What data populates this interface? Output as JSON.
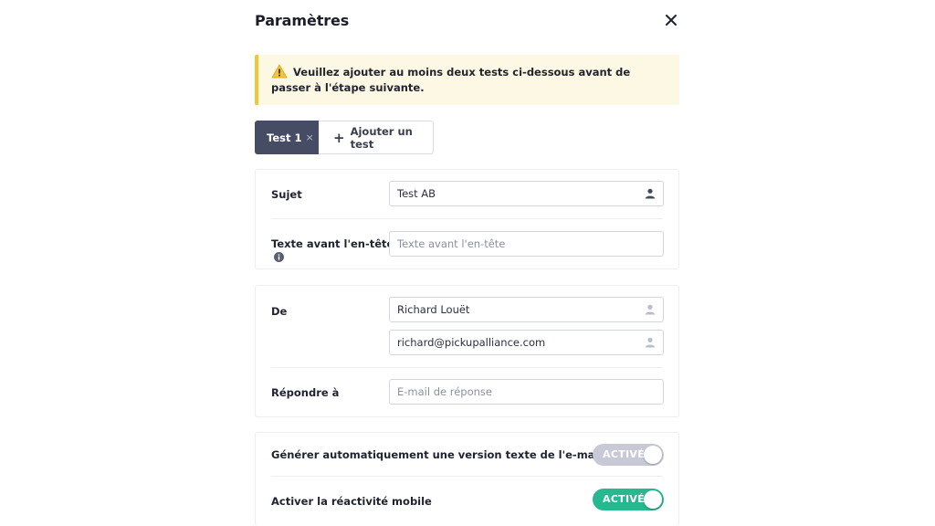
{
  "dialog": {
    "title": "Paramètres",
    "close_icon": "close-icon"
  },
  "alert": {
    "icon": "warning-icon",
    "text": "Veuillez ajouter au moins deux tests ci-dessous avant de passer à l'étape suivante."
  },
  "tabs": {
    "active_label": "Test 1",
    "active_remove": "×",
    "add_label": "Ajouter un test",
    "add_icon": "plus-icon"
  },
  "subject_section": {
    "subject_label": "Sujet",
    "subject_value": "Test AB",
    "preheader_label": "Texte avant l'en-tête",
    "preheader_placeholder": "Texte avant l'en-tête"
  },
  "sender_section": {
    "from_label": "De",
    "from_name": "Richard Louët",
    "from_email": "richard@pickupalliance.com",
    "reply_label": "Répondre à",
    "reply_placeholder": "E-mail de réponse"
  },
  "options_section": {
    "auto_text_label": "Générer automatiquement une version texte de l'e-mail",
    "auto_text_toggle": "ACTIVÉ",
    "auto_text_on": true,
    "mobile_label": "Activer la réactivité mobile",
    "mobile_toggle": "ACTIVÉ",
    "mobile_on": true
  },
  "colors": {
    "alert_bg": "#fdf8e3",
    "alert_border": "#f2c53c",
    "tab_active_bg": "#464c63",
    "toggle_green": "#28b88f",
    "toggle_grey": "#c7cad6"
  }
}
